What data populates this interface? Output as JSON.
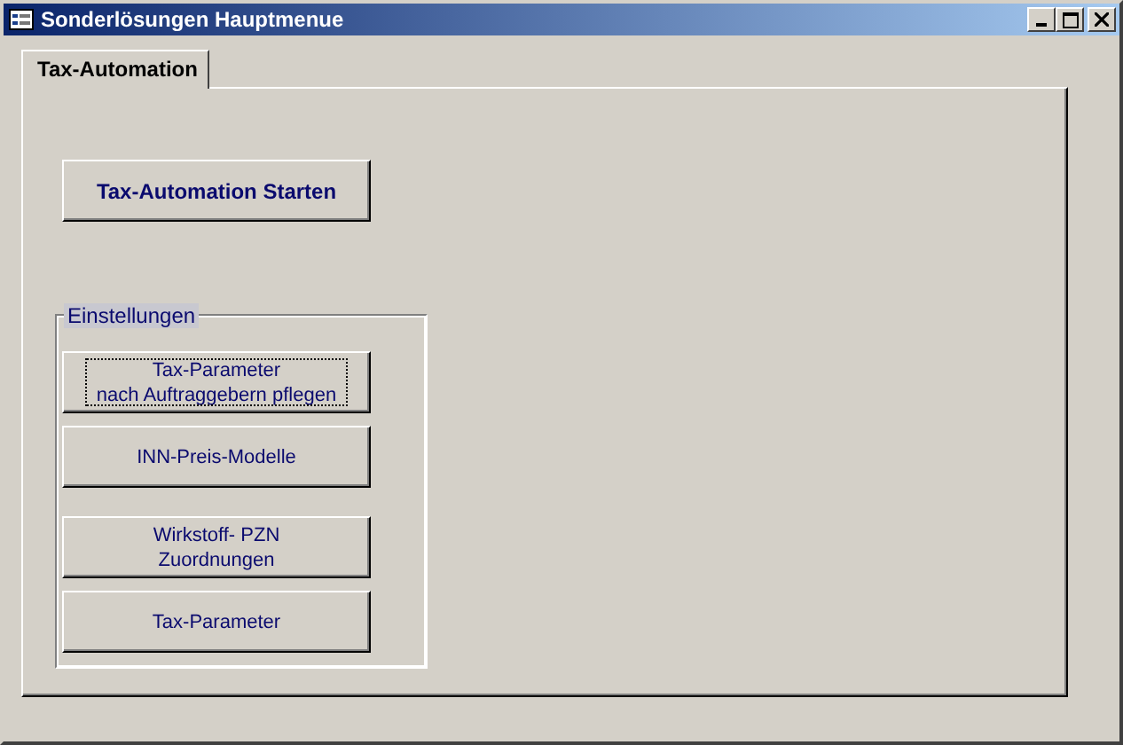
{
  "window": {
    "title": "Sonderlösungen Hauptmenue"
  },
  "tabs": [
    {
      "label": "Tax-Automation",
      "selected": true
    }
  ],
  "start_button": {
    "label": "Tax-Automation Starten"
  },
  "settings": {
    "legend": "Einstellungen",
    "buttons": [
      {
        "lines": [
          "Tax-Parameter",
          "nach Auftraggebern pflegen"
        ],
        "focused": true
      },
      {
        "lines": [
          "INN-Preis-Modelle"
        ],
        "focused": false
      },
      {
        "lines": [
          "Wirkstoff- PZN",
          "Zuordnungen"
        ],
        "focused": false
      },
      {
        "lines": [
          "Tax-Parameter"
        ],
        "focused": false
      }
    ]
  }
}
